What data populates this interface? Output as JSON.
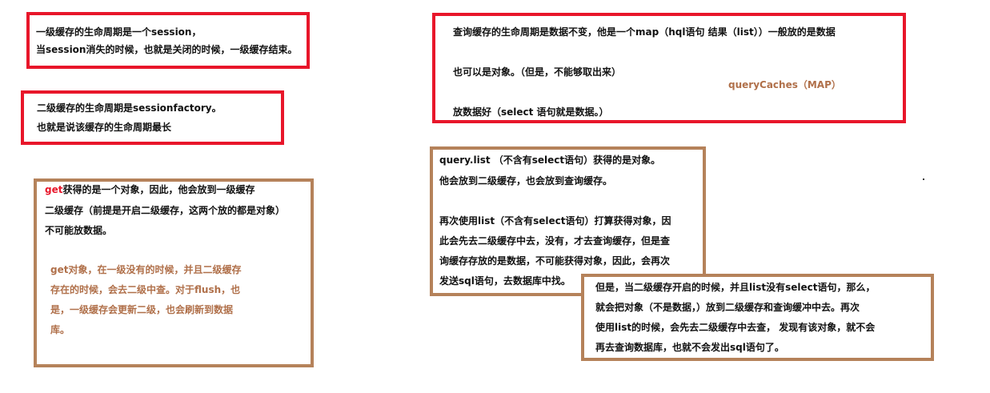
{
  "box1": {
    "lines": [
      "一级缓存的生命周期是一个session，",
      "当session消失的时候，也就是关闭的时候，一级缓存结束。"
    ]
  },
  "box2": {
    "lines": [
      "二级缓存的生命周期是sessionfactory。",
      "也就是说该缓存的生命周期最长"
    ]
  },
  "box3": {
    "get_word": "get",
    "line1_rest": "获得的是一个对象，因此，他会放到一级缓存",
    "lines": [
      "二级缓存（前提是开启二级缓存，这两个放的都是对象）",
      "不可能放数据。"
    ],
    "note_lines": [
      "get对象，在一级没有的时候，并且二级缓存",
      "存在的时候，会去二级中查。对于flush，也",
      "是，一级缓存会更新二级，也会刷新到数据",
      "库。"
    ]
  },
  "box4": {
    "lines": [
      "查询缓存的生命周期是数据不变，他是一个map（hql语句     结果（list））一般放的是数据",
      "也可以是对象。（但是，不能够取出来）",
      "放数据好（select 语句就是数据。）"
    ],
    "annotation": "queryCaches（MAP）"
  },
  "box5": {
    "lines": [
      "query.list （不含有select语句）获得的是对象。",
      "他会放到二级缓存，也会放到查询缓存。",
      "再次使用list（不含有select语句）打算获得对象，因",
      "此会先去二级缓存中去，没有，才去查询缓存，但是查",
      "询缓存存放的是数据，不可能获得对象，因此，会再次",
      "发送sql语句，去数据库中找。"
    ]
  },
  "box6": {
    "lines": [
      "但是，当二级缓存开启的时候，并且list没有select语句，那么，",
      "就会把对象（不是数据，）放到二级缓存和查询缓冲中去。再次",
      "使用list的时候，会先去二级缓存中去查， 发现有该对象，就不会",
      "再去查询数据库，也就不会发出sql语句了。"
    ]
  },
  "colors": {
    "red_border": "#e8162a",
    "brown_border": "#b5825a",
    "brown_text": "#b0704a"
  }
}
